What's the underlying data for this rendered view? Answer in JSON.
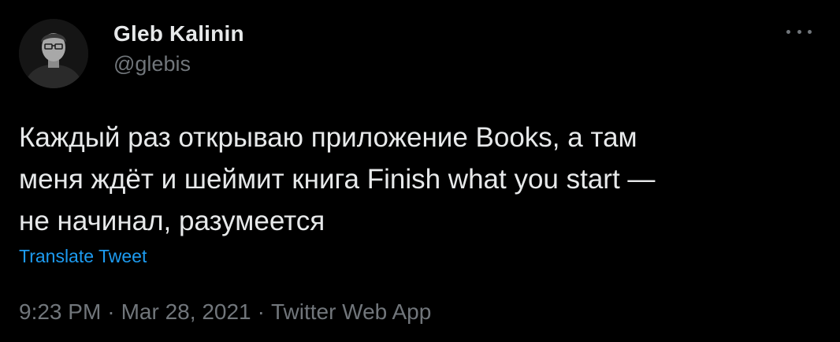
{
  "author": {
    "display_name": "Gleb Kalinin",
    "handle": "@glebis"
  },
  "tweet": {
    "text": "Каждый раз открываю приложение Books, а там\nменя ждёт и шеймит книга Finish what you start —\nне начинал, разумеется",
    "translate_label": "Translate Tweet",
    "time": "9:23 PM",
    "date": "Mar 28, 2021",
    "source": "Twitter Web App",
    "separator": "·"
  },
  "icons": {
    "more": "more-horizontal-icon",
    "avatar": "avatar-photo"
  },
  "colors": {
    "background": "#000000",
    "primary_text": "#e7e9ea",
    "secondary_text": "#71767b",
    "link": "#1d9bf0"
  }
}
